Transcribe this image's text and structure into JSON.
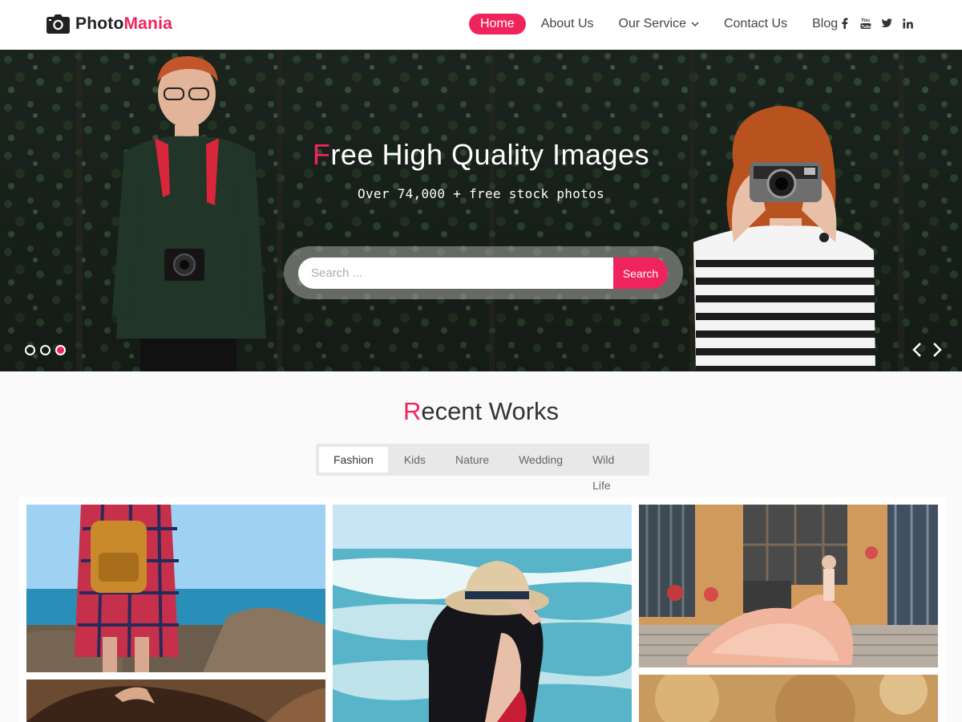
{
  "header": {
    "logo_part1": "Photo",
    "logo_part2": "Mania",
    "logo_icon": "camera-icon",
    "nav": [
      {
        "label": "Home",
        "active": true
      },
      {
        "label": "About Us"
      },
      {
        "label": "Our Service",
        "has_dropdown": true
      },
      {
        "label": "Contact Us"
      },
      {
        "label": "Blog"
      }
    ],
    "social": [
      {
        "icon": "facebook-icon",
        "glyph": "f"
      },
      {
        "icon": "youtube-icon",
        "glyph": "You"
      },
      {
        "icon": "twitter-icon",
        "glyph": "t"
      },
      {
        "icon": "linkedin-icon",
        "glyph": "in"
      }
    ]
  },
  "hero": {
    "title_first_letter": "F",
    "title_rest": "ree High Quality Images",
    "subtitle": "Over 74,000 + free stock photos",
    "search_placeholder": "Search ...",
    "search_button": "Search",
    "slides_total": 3,
    "active_slide": 3
  },
  "recent_works": {
    "title_first_letter": "R",
    "title_rest": "ecent Works",
    "tabs": [
      {
        "label": "Fashion",
        "active": true
      },
      {
        "label": "Kids"
      },
      {
        "label": "Nature"
      },
      {
        "label": "Wedding"
      },
      {
        "label": "Wild Life"
      }
    ]
  },
  "colors": {
    "accent": "#f0245c",
    "text_dark": "#333333",
    "page_bg": "#fafafa"
  }
}
